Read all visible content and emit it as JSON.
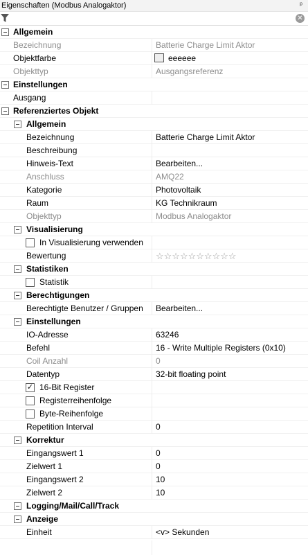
{
  "panel": {
    "title": "Eigenschaften (Modbus Analogaktor)",
    "pin_glyph": "ᵖ",
    "filter": {
      "value": "",
      "placeholder": ""
    },
    "clear_glyph": "✕"
  },
  "rows": {
    "allgemein": "Allgemein",
    "bezeichnung_label": "Bezeichnung",
    "bezeichnung_value": "Batterie Charge Limit Aktor",
    "objektfarbe_label": "Objektfarbe",
    "objektfarbe_value": "eeeeee",
    "objektfarbe_color": "#eeeeee",
    "objekttyp_label": "Objekttyp",
    "objekttyp_value": "Ausgangsreferenz",
    "einstellungen": "Einstellungen",
    "ausgang_label": "Ausgang",
    "ausgang_value": "",
    "referenziertes_objekt": "Referenziertes Objekt",
    "ref_allgemein": "Allgemein",
    "ref_bezeichnung_label": "Bezeichnung",
    "ref_bezeichnung_value": "Batterie Charge Limit Aktor",
    "beschreibung_label": "Beschreibung",
    "beschreibung_value": "",
    "hinweis_label": "Hinweis-Text",
    "hinweis_value": "Bearbeiten...",
    "anschluss_label": "Anschluss",
    "anschluss_value": "AMQ22",
    "kategorie_label": "Kategorie",
    "kategorie_value": "Photovoltaik",
    "raum_label": "Raum",
    "raum_value": "KG Technikraum",
    "ref_objekttyp_label": "Objekttyp",
    "ref_objekttyp_value": "Modbus Analogaktor",
    "visualisierung": "Visualisierung",
    "in_vis_label": "In Visualisierung verwenden",
    "in_vis_checked": false,
    "bewertung_label": "Bewertung",
    "bewertung_stars": "☆☆☆☆☆☆☆☆☆☆",
    "bewertung_value": 0,
    "bewertung_max": 10,
    "statistiken": "Statistiken",
    "statistik_label": "Statistik",
    "statistik_checked": false,
    "berechtigungen": "Berechtigungen",
    "berechtigte_label": "Berechtigte Benutzer / Gruppen",
    "berechtigte_value": "Bearbeiten...",
    "ref_einstellungen": "Einstellungen",
    "io_label": "IO-Adresse",
    "io_value": "63246",
    "befehl_label": "Befehl",
    "befehl_value": "16 - Write Multiple Registers (0x10)",
    "coil_label": "Coil Anzahl",
    "coil_value": "0",
    "datentyp_label": "Datentyp",
    "datentyp_value": "32-bit floating point",
    "bit16_label": "16-Bit Register",
    "bit16_check": "✓",
    "bit16_checked": true,
    "registerreihenfolge_label": "Registerreihenfolge",
    "registerreihenfolge_checked": false,
    "bytereihenfolge_label": "Byte-Reihenfolge",
    "bytereihenfolge_checked": false,
    "repetition_label": "Repetition Interval",
    "repetition_value": "0",
    "korrektur": "Korrektur",
    "eingangswert1_label": "Eingangswert 1",
    "eingangswert1_value": "0",
    "zielwert1_label": "Zielwert 1",
    "zielwert1_value": "0",
    "eingangswert2_label": "Eingangswert 2",
    "eingangswert2_value": "10",
    "zielwert2_label": "Zielwert 2",
    "zielwert2_value": "10",
    "logging": "Logging/Mail/Call/Track",
    "anzeige": "Anzeige",
    "einheit_label": "Einheit",
    "einheit_value": "<v> Sekunden"
  },
  "colors": {
    "disabled_text": "#8c8c8c",
    "grid_line": "#ececec",
    "titlebar_bg": "#f3f3f3"
  }
}
